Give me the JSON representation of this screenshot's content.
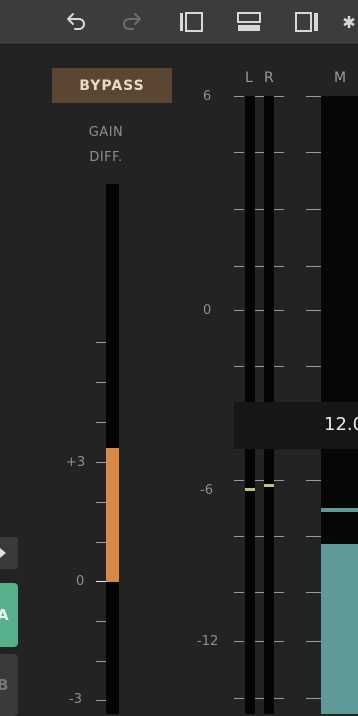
{
  "toolbar": {
    "icons": [
      "undo-icon",
      "redo-icon",
      "layout-left-panel-icon",
      "layout-bottom-panel-icon",
      "layout-right-panel-icon",
      "more-icon"
    ]
  },
  "bypass": {
    "label": "BYPASS"
  },
  "gain_diff": {
    "label_line1": "GAIN",
    "label_line2": "DIFF.",
    "scale_labels": [
      "+3",
      "0",
      "-3"
    ],
    "value_db": 3,
    "fill_color": "#d68a45"
  },
  "level_meter": {
    "channel_left": "L",
    "channel_right": "R",
    "mid_label": "M",
    "scale_labels": [
      "6",
      "0",
      "-6",
      "-12"
    ],
    "left_peak_db": -6.0,
    "right_peak_db": -5.8,
    "readout": "12.0",
    "mid_level_color": "#5e9a98"
  },
  "side_tabs": {
    "a_label": "A",
    "b_label": "B"
  }
}
